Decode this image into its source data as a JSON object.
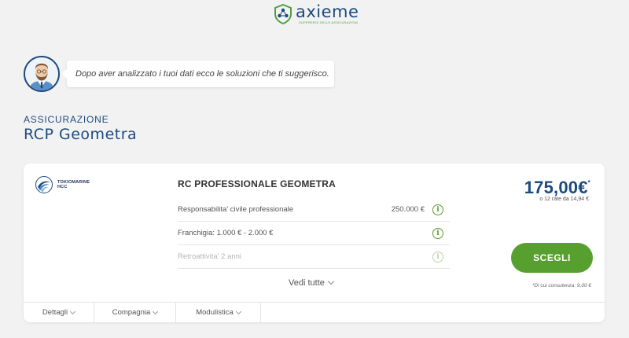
{
  "header": {
    "logo_name": "axieme",
    "logo_tagline": "SUPEREROI DELLE ASSICURAZIONI"
  },
  "advisor": {
    "message": "Dopo aver analizzato i tuoi dati ecco le soluzioni che ti suggerisco."
  },
  "section": {
    "label": "ASSICURAZIONE",
    "title": "RCP Geometra"
  },
  "offer": {
    "company_line1": "TOKIOMARINE",
    "company_line2": "HCC",
    "product_title": "RC PROFESSIONALE GEOMETRA",
    "coverages": [
      {
        "label": "Responsabilita' civile professionale",
        "value": "250.000 €"
      },
      {
        "label": "Franchigia: 1.000 € - 2.000 €",
        "value": ""
      },
      {
        "label": "Retroattivita' 2 anni",
        "value": ""
      }
    ],
    "info_glyph": "i",
    "view_all": "Vedi tutte",
    "price": "175,00€",
    "price_mark": "*",
    "installments": "o 12 rate da 14,94 €",
    "choose_label": "SCEGLI",
    "consult_note": "*Di cui consulenza: 9,00 €",
    "tabs": [
      "Dettagli",
      "Compagnia",
      "Modulistica"
    ]
  },
  "colors": {
    "brand_blue": "#1c4a80",
    "accent_green": "#57a02f",
    "background": "#f2f2f3"
  }
}
